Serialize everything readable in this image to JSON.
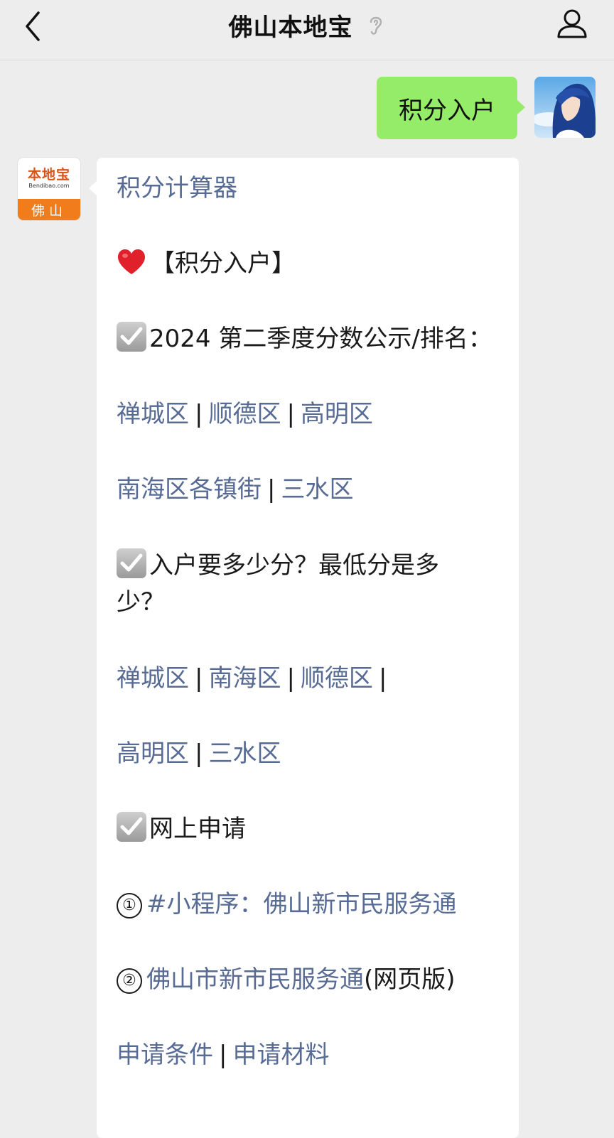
{
  "header": {
    "title": "佛山本地宝"
  },
  "outgoing": {
    "message": "积分入户"
  },
  "bot": {
    "logo_text": "本地宝",
    "logo_domain": "Bendibao.com",
    "logo_city": "佛山"
  },
  "message": {
    "calculator": "积分计算器",
    "section_title": "【积分入户】",
    "notice_2024": "2024 第二季度分数公示/排名：",
    "rank_links_row1": [
      "禅城区",
      "顺德区",
      "高明区"
    ],
    "rank_links_row2": [
      "南海区各镇街",
      "三水区"
    ],
    "question_line1": "入户要多少分？最低分是多",
    "question_line2": "少？",
    "min_links_row1": [
      "禅城区",
      "南海区",
      "顺德区"
    ],
    "min_links_row2": [
      "高明区",
      "三水区"
    ],
    "apply_online": "网上申请",
    "mini_num": "①",
    "mini_tag": "#小程序：佛山新市民服务通",
    "web_num": "②",
    "web_link": "佛山市新市民服务通",
    "web_suffix": "(网页版)",
    "cond_links": [
      "申请条件",
      "申请材料"
    ]
  },
  "colors": {
    "link": "#576b95",
    "outgoing_bubble": "#95ec69",
    "background": "#ededed"
  },
  "icons": [
    "back-arrow-icon",
    "ear-icon",
    "person-icon",
    "heart-icon",
    "checkbox-icon"
  ]
}
